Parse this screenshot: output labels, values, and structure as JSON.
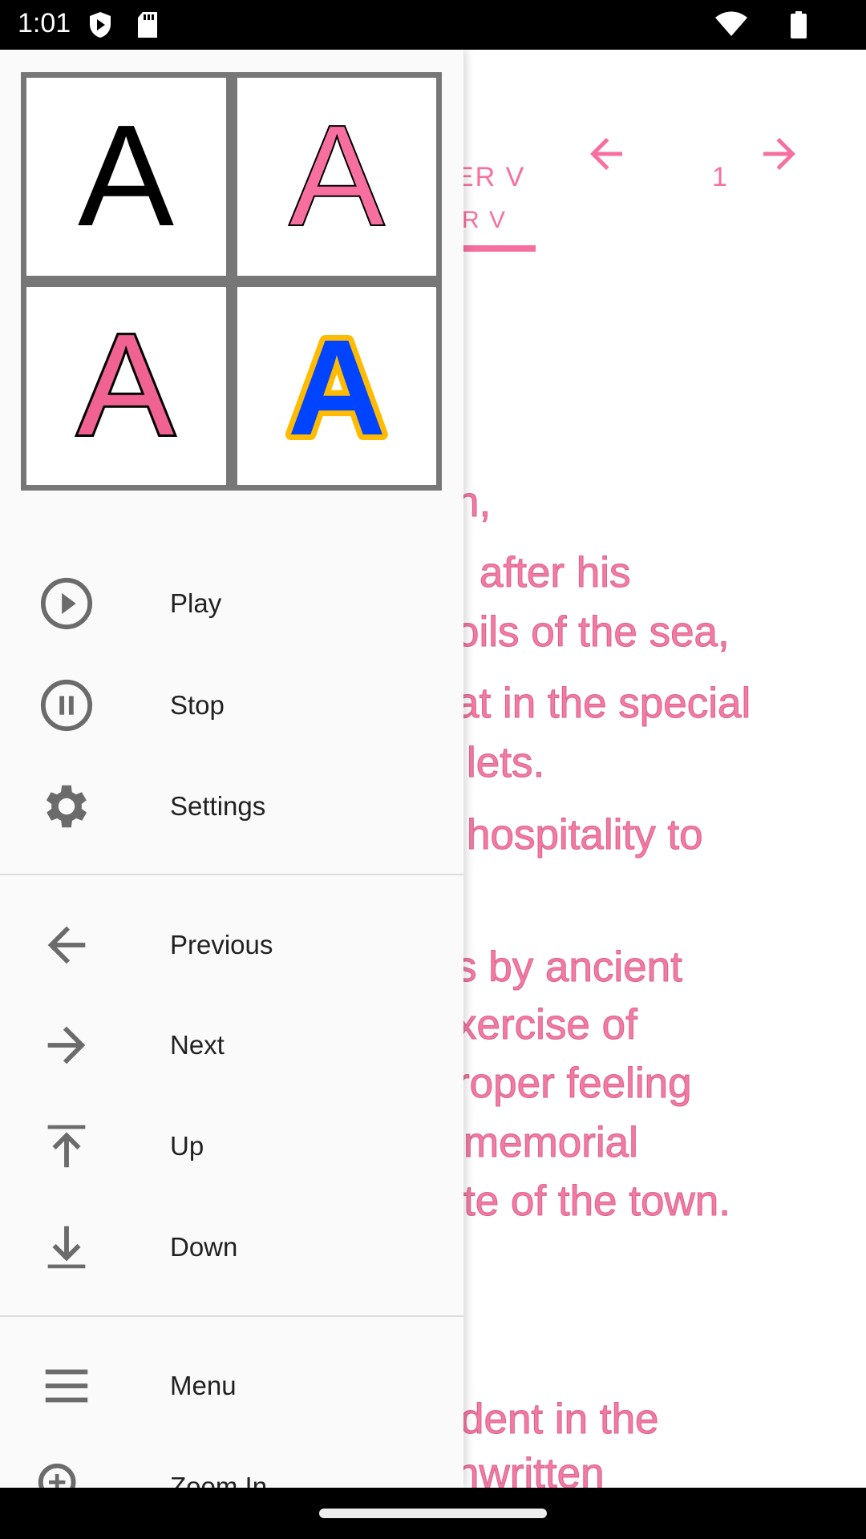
{
  "status_bar": {
    "time": "1:01",
    "icons": [
      "play-protect-icon",
      "sd-card-icon",
      "wifi-icon",
      "battery-icon"
    ]
  },
  "toolbar": {
    "prev_icon": "arrow-left-icon",
    "next_icon": "arrow-right-icon"
  },
  "tabs": {
    "tab1_line1": "ER V",
    "tab1_line2": "R V",
    "tab2": "1"
  },
  "content": {
    "lines": [
      "n,",
      "after his",
      "oils of the sea,",
      "at in the special",
      "lets.",
      "hospitality to",
      "s by ancient",
      "xercise of",
      "roper feeling",
      "memorial",
      "te of the town.",
      "dent in the",
      "nwritten"
    ]
  },
  "drawer": {
    "logo_letter": "A",
    "items": [
      {
        "label": "Play",
        "icon": "play-circle-icon"
      },
      {
        "label": "Stop",
        "icon": "pause-circle-icon"
      },
      {
        "label": "Settings",
        "icon": "gear-icon"
      },
      {
        "label": "Previous",
        "icon": "arrow-left-icon"
      },
      {
        "label": "Next",
        "icon": "arrow-right-icon"
      },
      {
        "label": "Up",
        "icon": "arrow-up-to-top-icon"
      },
      {
        "label": "Down",
        "icon": "arrow-down-to-bottom-icon"
      },
      {
        "label": "Menu",
        "icon": "menu-icon"
      },
      {
        "label": "Zoom In",
        "icon": "zoom-in-icon"
      }
    ]
  },
  "colors": {
    "accent": "#f76f9f",
    "text_pink": "#f27aa3",
    "icon_gray": "#6b6b6b",
    "logo_blue": "#0044ff",
    "logo_yellow": "#ffbb00"
  }
}
